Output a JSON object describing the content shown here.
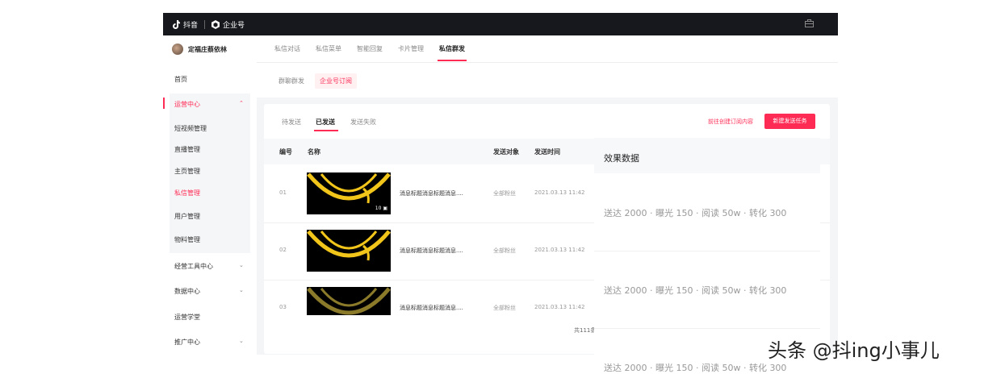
{
  "header": {
    "brand_primary": "抖音",
    "brand_secondary": "企业号",
    "bag_icon": "briefcase-icon"
  },
  "sidebar": {
    "user_name": "定福庄蔡依林",
    "items": [
      {
        "label": "首页"
      },
      {
        "label": "运营中心",
        "expanded": true
      },
      {
        "label": "短视频管理"
      },
      {
        "label": "直播管理"
      },
      {
        "label": "主页管理"
      },
      {
        "label": "私信管理",
        "active": true
      },
      {
        "label": "用户管理"
      },
      {
        "label": "物料管理"
      },
      {
        "label": "经营工具中心"
      },
      {
        "label": "数据中心"
      },
      {
        "label": "运营学堂"
      },
      {
        "label": "推广中心"
      }
    ]
  },
  "tabs_primary": [
    "私信对话",
    "私信菜单",
    "智能回复",
    "卡片管理",
    "私信群发"
  ],
  "tabs_secondary": [
    "群聊群发",
    "企业号订阅"
  ],
  "panel": {
    "tabs": [
      "待发送",
      "已发送",
      "发送失败"
    ],
    "link_label": "前往创建订阅内容",
    "create_button": "新建发送任务",
    "columns": [
      "编号",
      "名称",
      "发送对象",
      "发送时间"
    ],
    "rows": [
      {
        "id": "01",
        "title": "消息标题消息标题消息....",
        "target": "全部粉丝",
        "time": "2021.03.13 11:42",
        "badge": "10"
      },
      {
        "id": "02",
        "title": "消息标题消息标题消息....",
        "target": "全部粉丝",
        "time": "2021.03.13 11:42"
      },
      {
        "id": "03",
        "title": "消息标题消息标题消息....",
        "target": "全部粉丝",
        "time": "2021.03.13 11:42"
      }
    ],
    "total": "共111条"
  },
  "overlay": {
    "title": "效果数据",
    "rows": [
      "送达 2000 · 曝光 150 · 阅读 50w · 转化 300",
      "送达 2000 · 曝光 150 · 阅读 50w · 转化 300",
      "送达 2000 · 曝光 150 · 阅读 50w · 转化 300"
    ]
  },
  "watermark": "头条 @抖ing小事儿",
  "colors": {
    "accent": "#fe2c55",
    "topbar": "#16181d",
    "thumb_yellow": "#f2c51a"
  }
}
